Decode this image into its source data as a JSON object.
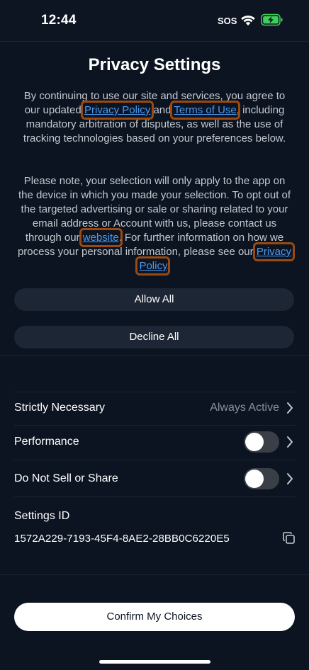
{
  "status_bar": {
    "time": "12:44",
    "sos": "SOS"
  },
  "title": "Privacy Settings",
  "intro": {
    "text_1": "By continuing to use our site and services, you agree to our updated ",
    "link_privacy": "Privacy Policy",
    "text_2": " and ",
    "link_terms": "Terms of Use",
    "text_3": ", including mandatory arbitration of disputes, as well as the use of tracking technologies based on your preferences below."
  },
  "note": {
    "text_1": "Please note, your selection will only apply to the app on the device in which you made your selection. To opt out of the targeted advertising or sale or sharing related to your email address or Account with us, please contact us through our ",
    "link_website": "website",
    "text_2": ". For further information on how we process your personal information, please see our ",
    "link_privacy": "Privacy Policy",
    "text_3": "."
  },
  "buttons": {
    "allow_all": "Allow All",
    "decline_all": "Decline All",
    "confirm": "Confirm My Choices"
  },
  "categories": [
    {
      "label": "Strictly Necessary",
      "status": "Always Active"
    },
    {
      "label": "Performance",
      "enabled": false
    },
    {
      "label": "Do Not Sell or Share",
      "enabled": false
    }
  ],
  "settings_id": {
    "label": "Settings ID",
    "value": "1572A229-7193-45F4-8AE2-28BB0C6220E5"
  },
  "colors": {
    "background": "#0c1421",
    "link": "#4a9af5",
    "highlight_box": "#9a4a10",
    "pill": "#1d2634",
    "toggle_off": "#3a3f47"
  }
}
